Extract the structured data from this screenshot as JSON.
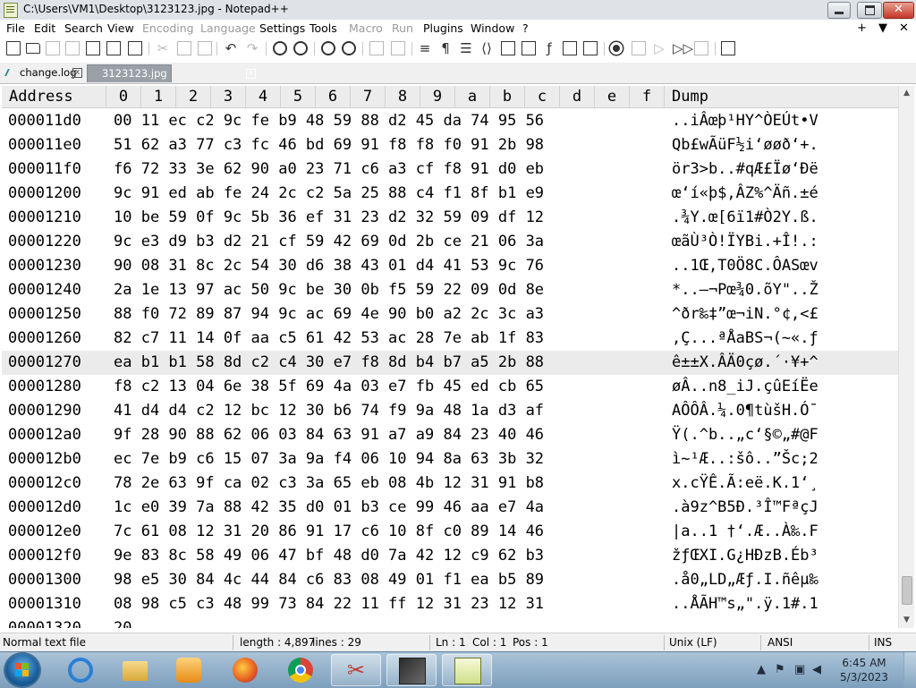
{
  "window": {
    "title": "C:\\Users\\VM1\\Desktop\\3123123.jpg - Notepad++",
    "close_glyph": "✕"
  },
  "menu": {
    "items": [
      "File",
      "Edit",
      "Search",
      "View",
      "Encoding",
      "Language",
      "Settings",
      "Tools",
      "Macro",
      "Run",
      "Plugins",
      "Window",
      "?"
    ],
    "disabled": [
      "Encoding",
      "Language",
      "Macro",
      "Run"
    ],
    "right_controls": [
      "+",
      "▼",
      "✕"
    ]
  },
  "tabs": [
    {
      "label": "change.log",
      "active": false,
      "close_glyph": "x"
    },
    {
      "label": "3123123.jpg",
      "active": true,
      "close_glyph": "x"
    }
  ],
  "hex": {
    "header": {
      "address": "Address",
      "columns": [
        "0",
        "1",
        "2",
        "3",
        "4",
        "5",
        "6",
        "7",
        "8",
        "9",
        "a",
        "b",
        "c",
        "d",
        "e",
        "f"
      ],
      "dump": "Dump"
    },
    "rows": [
      {
        "address": "000011d0",
        "bytes": "00 11 ec c2 9c fe b9 48 59 88 d2 45 da 74 95 56",
        "dump": "..iÂœþ¹HY^ÒEÚt•V"
      },
      {
        "address": "000011e0",
        "bytes": "51 62 a3 77 c3 fc 46 bd 69 91 f8 f8 f0 91 2b 98",
        "dump": "Qb£wÃüF½i‘øøð‘+."
      },
      {
        "address": "000011f0",
        "bytes": "f6 72 33 3e 62 90 a0 23 71 c6 a3 cf f8 91 d0 eb",
        "dump": "ör3>b..#qÆ£Ïø‘Ðë"
      },
      {
        "address": "00001200",
        "bytes": "9c 91 ed ab fe 24 2c c2 5a 25 88 c4 f1 8f b1 e9",
        "dump": "œ‘í«þ$,ÂZ%^Äñ.±é"
      },
      {
        "address": "00001210",
        "bytes": "10 be 59 0f 9c 5b 36 ef 31 23 d2 32 59 09 df 12",
        "dump": ".¾Y.œ[6ï1#Ò2Y.ß."
      },
      {
        "address": "00001220",
        "bytes": "9c e3 d9 b3 d2 21 cf 59 42 69 0d 2b ce 21 06 3a",
        "dump": "œãÙ³Ò!ÏYBi.+Î!.:"
      },
      {
        "address": "00001230",
        "bytes": "90 08 31 8c 2c 54 30 d6 38 43 01 d4 41 53 9c 76",
        "dump": "..1Œ,T0Ö8C.ÔASœv"
      },
      {
        "address": "00001240",
        "bytes": "2a 1e 13 97 ac 50 9c be 30 0b f5 59 22 09 0d 8e",
        "dump": "*..—¬Pœ¾0.õY\"..Ž"
      },
      {
        "address": "00001250",
        "bytes": "88 f0 72 89 87 94 9c ac 69 4e 90 b0 a2 2c 3c a3",
        "dump": "^ðr‰‡”œ¬iN.°¢,<£"
      },
      {
        "address": "00001260",
        "bytes": "82 c7 11 14 0f aa c5 61 42 53 ac 28 7e ab 1f 83",
        "dump": ",Ç...ªÅaBS¬(~«.ƒ"
      },
      {
        "address": "00001270",
        "bytes": "ea b1 b1 58 8d c2 c4 30 e7 f8 8d b4 b7 a5 2b 88",
        "dump": "ê±±X.ÂÄ0çø.´·¥+^",
        "highlight": true
      },
      {
        "address": "00001280",
        "bytes": "f8 c2 13 04 6e 38 5f 69 4a 03 e7 fb 45 ed cb 65",
        "dump": "øÂ..n8_iJ.çûEíËe"
      },
      {
        "address": "00001290",
        "bytes": "41 d4 d4 c2 12 bc 12 30 b6 74 f9 9a 48 1a d3 af",
        "dump": "AÔÔÂ.¼.0¶tùšH.Ó¯"
      },
      {
        "address": "000012a0",
        "bytes": "9f 28 90 88 62 06 03 84 63 91 a7 a9 84 23 40 46",
        "dump": "Ÿ(.^b..„c‘§©„#@F"
      },
      {
        "address": "000012b0",
        "bytes": "ec 7e b9 c6 15 07 3a 9a f4 06 10 94 8a 63 3b 32",
        "dump": "ì~¹Æ..:šô..”Šc;2"
      },
      {
        "address": "000012c0",
        "bytes": "78 2e 63 9f ca 02 c3 3a 65 eb 08 4b 12 31 91 b8",
        "dump": "x.cŸÊ.Ã:eë.K.1‘¸"
      },
      {
        "address": "000012d0",
        "bytes": "1c e0 39 7a 88 42 35 d0 01 b3 ce 99 46 aa e7 4a",
        "dump": ".à9z^B5Ð.³Î™FªçJ"
      },
      {
        "address": "000012e0",
        "bytes": "7c 61 08 12 31 20 86 91 17 c6 10 8f c0 89 14 46",
        "dump": "|a..1 †‘.Æ..À‰.F"
      },
      {
        "address": "000012f0",
        "bytes": "9e 83 8c 58 49 06 47 bf 48 d0 7a 42 12 c9 62 b3",
        "dump": "žƒŒXI.G¿HÐzB.Éb³"
      },
      {
        "address": "00001300",
        "bytes": "98 e5 30 84 4c 44 84 c6 83 08 49 01 f1 ea b5 89",
        "dump": ".å0„LD„Æƒ.I.ñêµ‰"
      },
      {
        "address": "00001310",
        "bytes": "08 98 c5 c3 48 99 73 84 22 11 ff 12 31 23 12 31",
        "dump": "..ÅÃH™s„\".ÿ.1#.1"
      },
      {
        "address": "00001320",
        "bytes": "20",
        "dump": "",
        "partial": true
      }
    ]
  },
  "scrollbar": {
    "up_glyph": "▲",
    "down_glyph": "▼",
    "position_fraction": 0.93
  },
  "statusbar": {
    "file_type": "Normal text file",
    "length": "length : 4,897",
    "lines": "lines : 29",
    "ln": "Ln : 1",
    "col": "Col : 1",
    "pos": "Pos : 1",
    "eol": "Unix (LF)",
    "encoding": "ANSI",
    "mode": "INS"
  },
  "taskbar": {
    "apps": [
      "internet-explorer",
      "file-explorer",
      "media-player",
      "firefox",
      "chrome",
      "snipping-tool",
      "screenshot-tool",
      "notepad-plus-plus"
    ],
    "active_app": "notepad-plus-plus",
    "clock_time": "6:45 AM",
    "clock_date": "5/3/2023",
    "colors": {
      "accent": "#1a5f9c",
      "taskbar": "#7d9fbd"
    }
  }
}
